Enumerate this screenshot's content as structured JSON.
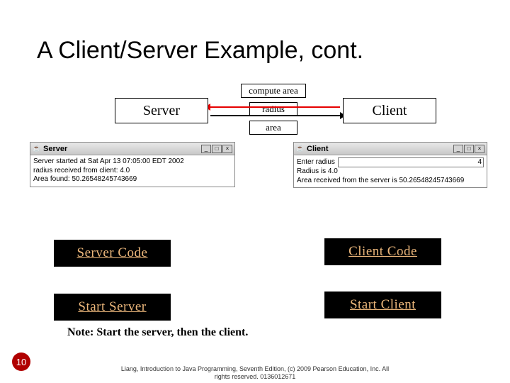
{
  "title": "A Client/Server Example, cont.",
  "diagram": {
    "server_box": "Server",
    "client_box": "Client",
    "label_top": "compute area",
    "label_mid": "radius",
    "label_bot": "area"
  },
  "server_window": {
    "title": "Server",
    "lines": [
      "Server started at Sat Apr 13 07:05:00 EDT 2002",
      "radius received from client: 4.0",
      "Area found: 50.26548245743669"
    ]
  },
  "client_window": {
    "title": "Client",
    "radius_label": "Enter radius",
    "radius_value": "4",
    "lines": [
      "Radius is 4.0",
      "Area received from the server is 50.26548245743669"
    ]
  },
  "buttons": {
    "server_code": "Server Code",
    "client_code": "Client Code",
    "start_server": "Start Server",
    "start_client": "Start Client"
  },
  "note": "Note: Start the server, then the client.",
  "slide_number": "10",
  "footer_line1": "Liang, Introduction to Java Programming, Seventh Edition, (c) 2009 Pearson Education, Inc. All",
  "footer_line2": "rights reserved. 0136012671",
  "window_controls": {
    "minimize": "_",
    "maximize": "□",
    "close": "×"
  }
}
